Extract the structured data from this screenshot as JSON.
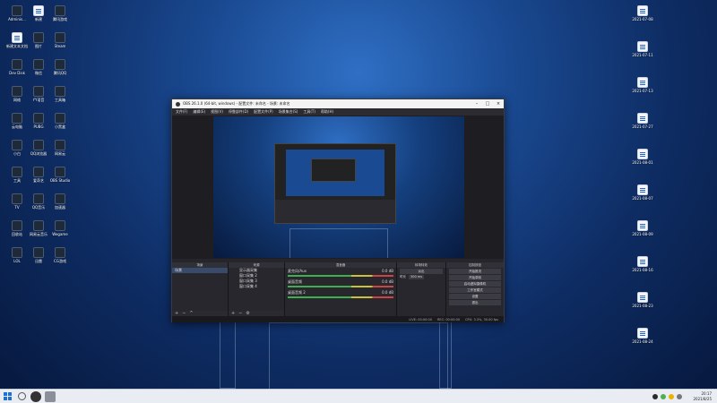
{
  "desktop": {
    "left_icons": [
      {
        "label": "Adminis...",
        "kind": "dark"
      },
      {
        "label": "新建文本文档",
        "kind": "doc"
      },
      {
        "label": "Dev Disk",
        "kind": "dark"
      },
      {
        "label": "网络",
        "kind": "dark"
      },
      {
        "label": "云电脑",
        "kind": "dark"
      },
      {
        "label": "小白",
        "kind": "dark"
      },
      {
        "label": "工具",
        "kind": "dark"
      },
      {
        "label": "TV",
        "kind": "dark"
      },
      {
        "label": "回收站",
        "kind": "dark"
      },
      {
        "label": "LOL",
        "kind": "dark"
      },
      {
        "label": "新建",
        "kind": "doc"
      },
      {
        "label": "图片",
        "kind": "dark"
      },
      {
        "label": "微信",
        "kind": "dark"
      },
      {
        "label": "YY语音",
        "kind": "dark"
      },
      {
        "label": "PUBG",
        "kind": "dark"
      },
      {
        "label": "QQ浏览器",
        "kind": "dark"
      },
      {
        "label": "爱奇艺",
        "kind": "dark"
      },
      {
        "label": "QQ音乐",
        "kind": "dark"
      },
      {
        "label": "网易云音乐",
        "kind": "dark"
      },
      {
        "label": "迅雷",
        "kind": "dark"
      },
      {
        "label": "腾讯游戏",
        "kind": "dark"
      },
      {
        "label": "Steam",
        "kind": "dark"
      },
      {
        "label": "腾讯QQ",
        "kind": "dark"
      },
      {
        "label": "工具箱",
        "kind": "dark"
      },
      {
        "label": "小黑盒",
        "kind": "dark"
      },
      {
        "label": "网易云",
        "kind": "dark"
      },
      {
        "label": "OBS Studio",
        "kind": "dark"
      },
      {
        "label": "加速器",
        "kind": "dark"
      },
      {
        "label": "Wegame",
        "kind": "dark"
      },
      {
        "label": "CG游戏",
        "kind": "dark"
      }
    ],
    "right_icons": [
      {
        "label": "2021-07-08"
      },
      {
        "label": "2021-07-11"
      },
      {
        "label": "2021-07-13"
      },
      {
        "label": "2021-07-27"
      },
      {
        "label": "2021-08-01"
      },
      {
        "label": "2021-08-07"
      },
      {
        "label": "2021-08-09"
      },
      {
        "label": "2021-08-16"
      },
      {
        "label": "2021-08-23"
      },
      {
        "label": "2021-08-24"
      }
    ]
  },
  "obs": {
    "title": "OBS 26.1.0 (64-bit, windows) - 配置文件: 未命名 - 场景: 未命名",
    "menu": [
      "文件(F)",
      "编辑(E)",
      "视图(V)",
      "停靠部件(D)",
      "配置文件(P)",
      "场景集合(S)",
      "工具(T)",
      "帮助(H)"
    ],
    "docks": {
      "scenes_header": "场景",
      "sources_header": "来源",
      "mixer_header": "混音器",
      "transitions_header": "转场特效",
      "controls_header": "控制按钮",
      "scene_item": "场景",
      "sources": [
        "显示器采集",
        "窗口采集 2",
        "窗口采集 3",
        "窗口采集 4"
      ],
      "mixer": [
        {
          "name": "麦克风/Aux",
          "level": "0.0 dB"
        },
        {
          "name": "桌面音频",
          "level": "0.0 dB"
        },
        {
          "name": "桌面音频 2",
          "level": "0.0 dB"
        }
      ],
      "transition_name": "淡出",
      "transition_duration_label": "时长",
      "transition_duration": "300 ms",
      "controls": [
        "开始推流",
        "开始录制",
        "启动虚拟摄像机",
        "工作室模式",
        "设置",
        "退出"
      ]
    },
    "status": {
      "live": "LIVE: 00:00:00",
      "rec": "REC: 00:00:00",
      "cpu": "CPU: 3.3%, 30.00 fps"
    }
  },
  "taskbar": {
    "time": "20:17",
    "date": "2021/8/25"
  },
  "colors": {
    "desktop_accent": "#1a4a92",
    "obs_bg": "#1e1e22",
    "meter_green": "#3fae4f"
  }
}
